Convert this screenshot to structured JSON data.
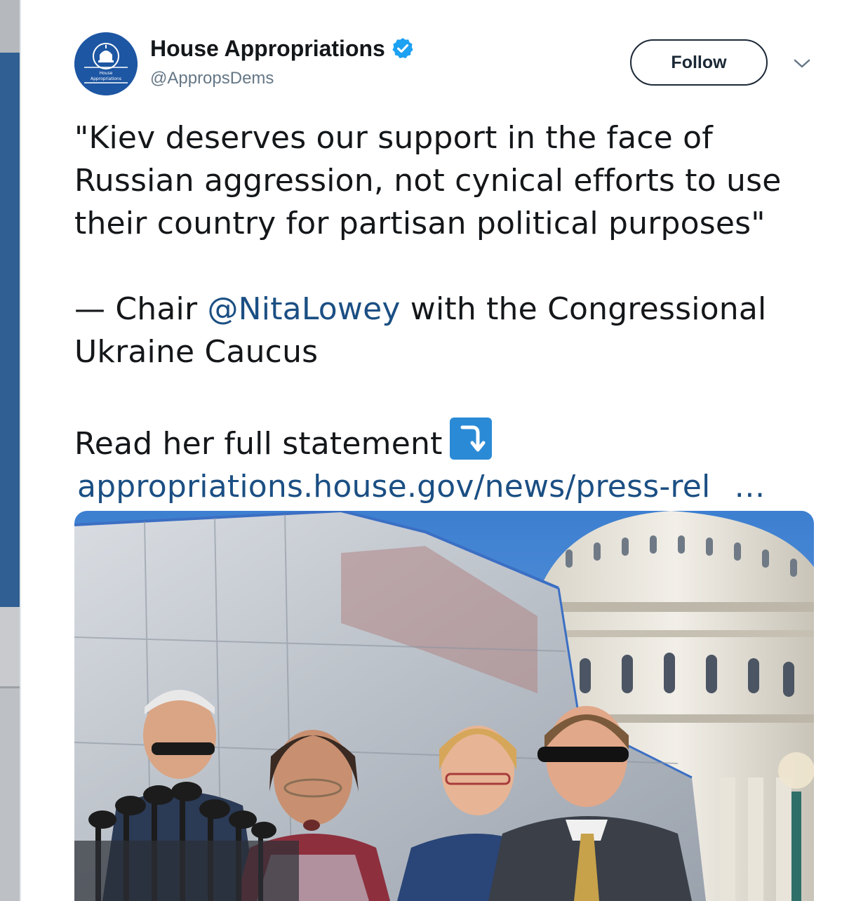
{
  "tweet": {
    "display_name": "House Appropriations",
    "handle": "@AppropsDems",
    "avatar_text_line1": "House",
    "avatar_text_line2": "Appropriations",
    "follow_label": "Follow",
    "quote": "\"Kiev deserves our support in the face of Russian aggression, not cynical efforts to use their country for partisan political purposes\"",
    "attribution_prefix": "— Chair ",
    "mention": "@NitaLowey",
    "attribution_suffix": " with the Congressional Ukraine Caucus",
    "read_more": "Read her full statement",
    "link_text": "appropriations.house.gov/news/press-rel",
    "link_ellipsis": "…",
    "verified_color": "#1da1f2",
    "accent_color": "#1b4f83"
  },
  "icons": {
    "verified": "verified-badge-icon",
    "chevron": "chevron-down-icon",
    "arrow_emoji": "right-arrow-curving-down-icon"
  },
  "media": {
    "description_icon": "capitol-press-conference-photo"
  }
}
